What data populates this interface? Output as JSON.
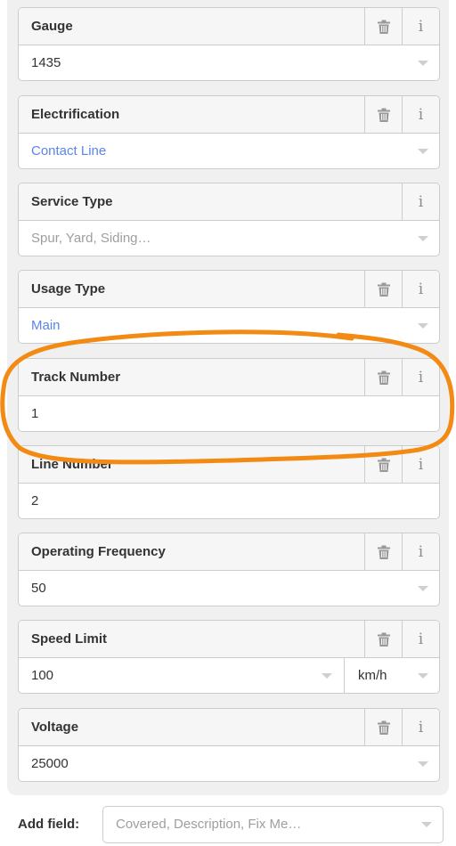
{
  "fields": [
    {
      "label": "Gauge",
      "value": "1435",
      "value_style": "text",
      "has_delete": true,
      "has_dropdown": true
    },
    {
      "label": "Electrification",
      "value": "Contact Line",
      "value_style": "tag",
      "has_delete": true,
      "has_dropdown": true
    },
    {
      "label": "Service Type",
      "value": "Spur, Yard, Siding…",
      "value_style": "placeholder",
      "has_delete": false,
      "has_dropdown": true
    },
    {
      "label": "Usage Type",
      "value": "Main",
      "value_style": "tag",
      "has_delete": true,
      "has_dropdown": true
    },
    {
      "label": "Track Number",
      "value": "1",
      "value_style": "text",
      "has_delete": true,
      "has_dropdown": false
    },
    {
      "label": "Line Number",
      "value": "2",
      "value_style": "text",
      "has_delete": true,
      "has_dropdown": false
    },
    {
      "label": "Operating Frequency",
      "value": "50",
      "value_style": "text",
      "has_delete": true,
      "has_dropdown": true
    },
    {
      "label": "Speed Limit",
      "value": "100",
      "value_style": "text",
      "has_delete": true,
      "has_dropdown": true,
      "unit": "km/h"
    },
    {
      "label": "Voltage",
      "value": "25000",
      "value_style": "text",
      "has_delete": true,
      "has_dropdown": true
    }
  ],
  "add_field": {
    "label": "Add field:",
    "placeholder": "Covered, Description, Fix Me…"
  },
  "icons": {
    "delete": "trash-icon",
    "info": "info-icon",
    "dropdown": "chevron-down-icon"
  },
  "colors": {
    "tag_value": "#5b86e5",
    "placeholder": "#9e9e9e",
    "annotation": "#f28a14"
  }
}
